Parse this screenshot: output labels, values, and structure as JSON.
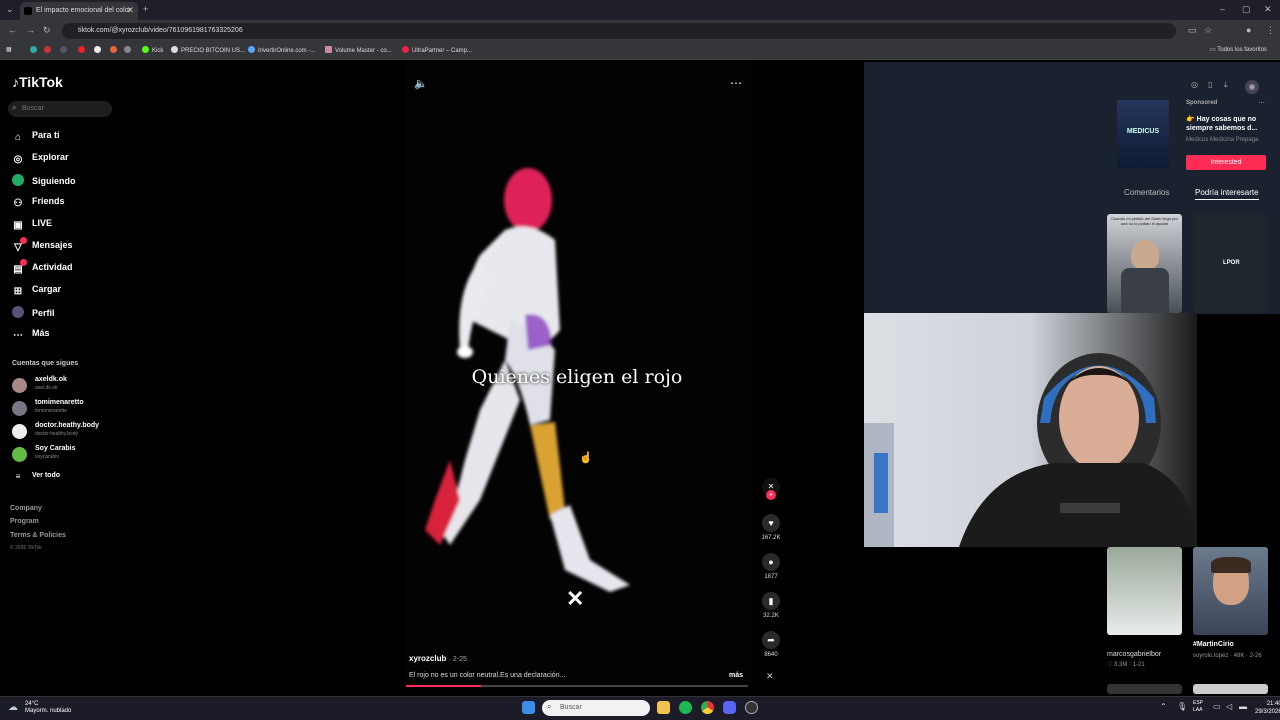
{
  "browser": {
    "tab_title": "El impacto emocional del color",
    "url": "tiktok.com/@xyrozclub/video/7610961981763325206",
    "bookmarks": [
      "Kick",
      "PRECIO BITCOIN US...",
      "InvertirOnline.com -...",
      "Volume Master - co...",
      "UltraPartner – Camp..."
    ],
    "bookmarks_folder": "Todos los favoritos"
  },
  "sidebar": {
    "logo": "TikTok",
    "search_placeholder": "Buscar",
    "nav": [
      {
        "label": "Para ti",
        "icon": "home-icon"
      },
      {
        "label": "Explorar",
        "icon": "compass-icon"
      },
      {
        "label": "Siguiendo",
        "icon": "following-icon"
      },
      {
        "label": "Friends",
        "icon": "friends-icon"
      },
      {
        "label": "LIVE",
        "icon": "live-icon"
      },
      {
        "label": "Mensajes",
        "icon": "messages-icon"
      },
      {
        "label": "Actividad",
        "icon": "activity-icon"
      },
      {
        "label": "Cargar",
        "icon": "upload-icon"
      },
      {
        "label": "Perfil",
        "icon": "profile-icon"
      },
      {
        "label": "Más",
        "icon": "more-icon"
      }
    ],
    "following_title": "Cuentas que sigues",
    "accounts": [
      {
        "name": "axeldk.ok",
        "handle": "axel.dk.ok"
      },
      {
        "name": "tomimenaretto",
        "handle": "tomimenaretto"
      },
      {
        "name": "doctor.heathy.body",
        "handle": "doctor.healthy.body"
      },
      {
        "name": "Soy Carabis",
        "handle": "soycarabis"
      }
    ],
    "see_all": "Ver todo",
    "footer": [
      "Company",
      "Program",
      "Terms & Policies"
    ],
    "copyright": "© 2026 TikTok"
  },
  "video": {
    "overlay_text": "Quienes eligen el rojo",
    "author": "xyrozclub",
    "date": "2-25",
    "description": "El rojo no es un color neutral.Es una declaración...",
    "more": "más",
    "progress": 0.22,
    "likes": "167.2K",
    "comments": "1877",
    "saves": "32.2K",
    "shares": "8640"
  },
  "right_panel": {
    "ad_brand": "MEDICUS",
    "sponsored": "Sponsored",
    "ad_title": "👉 Hay cosas que no siempre sabemos d...",
    "ad_sub": "Medicus Medicina Prepaga",
    "interested": "Interested",
    "tabs": [
      "Comentarios",
      "Podría interesarte"
    ],
    "thumb_text_1": "Cuando mi pedido del Shein llegó por una no lo podían ni ayudar",
    "thumb_text_2": "LPOR",
    "videos": [
      {
        "title": "marcosgabrielbor",
        "stats": "3.3M · 1-21"
      },
      {
        "title": "#MartinCirio",
        "stats": "soyrolo.lopez · 48K · 2-26"
      }
    ]
  },
  "taskbar": {
    "temp": "24°C",
    "weather": "Mayorm. nublado",
    "search": "Buscar",
    "lang_1": "ESP",
    "lang_2": "LAA",
    "time": "21:40",
    "date": "29/3/2026"
  },
  "colors": {
    "accent": "#fe2c55",
    "panel": "#1a2230"
  }
}
